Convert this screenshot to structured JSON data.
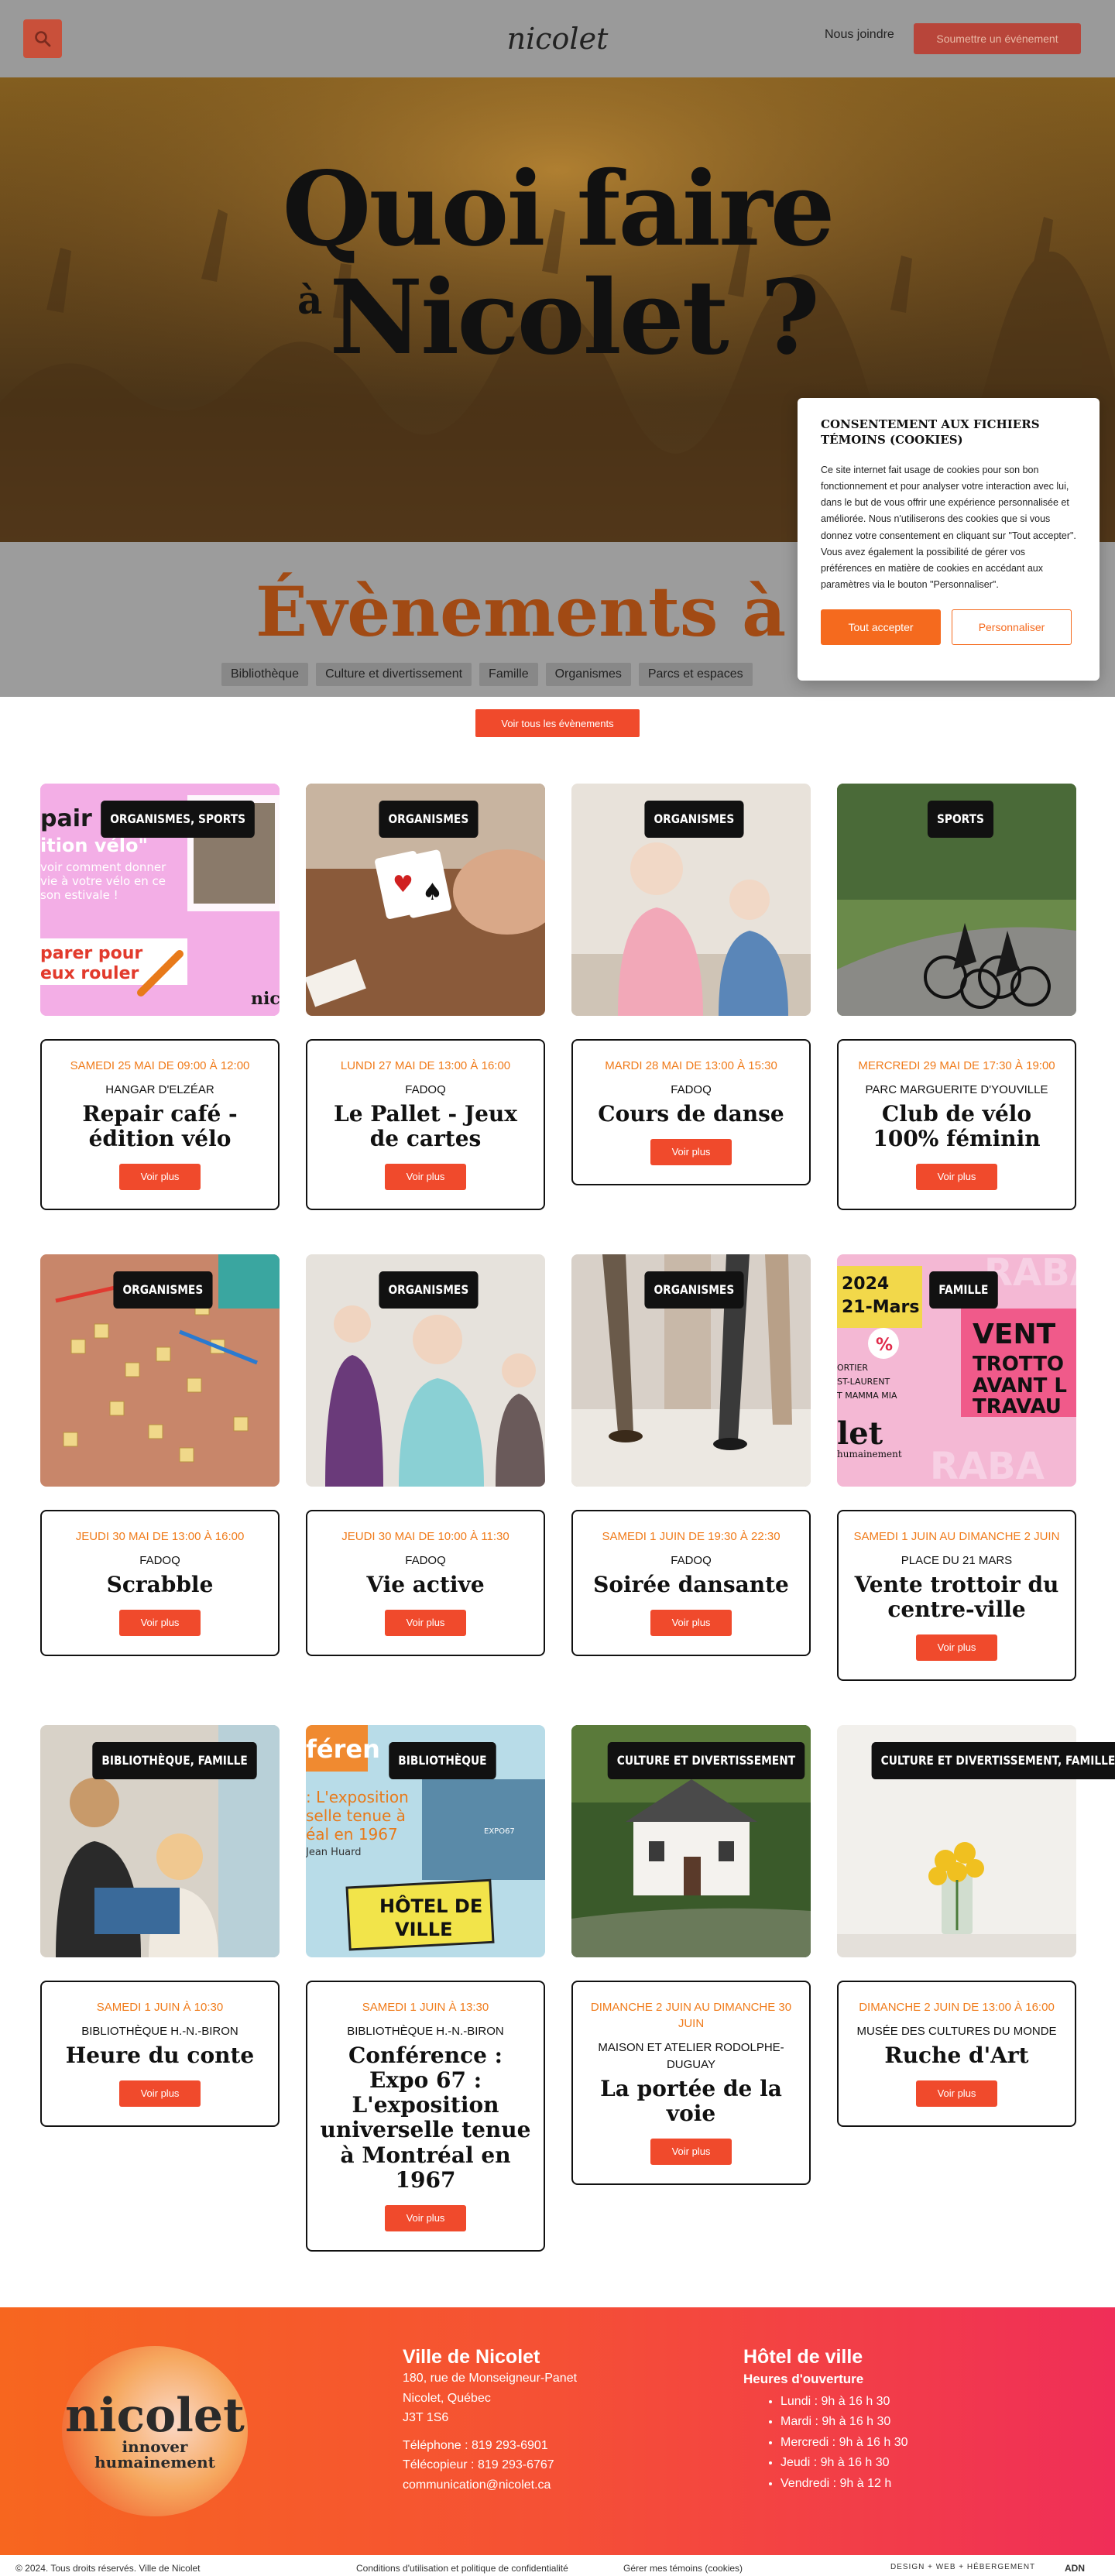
{
  "header": {
    "logo_text": "nicolet",
    "join_label": "Nous joindre",
    "submit_label": "Soumettre un événement"
  },
  "hero": {
    "line1": "Quoi faire",
    "small_a": "à",
    "line2": "Nicolet ?"
  },
  "events_section": {
    "title": "Évènements à venir",
    "filters": [
      "Bibliothèque",
      "Culture et divertissement",
      "Famille",
      "Organismes",
      "Parcs et espaces"
    ],
    "all_button": "Voir tous les évènements"
  },
  "cookie": {
    "title": "Consentement aux fichiers témoins (cookies)",
    "body": "Ce site internet fait usage de cookies pour son bon fonctionnement et pour analyser votre interaction avec lui, dans le but de vous offrir une expérience personnalisée et améliorée. Nous n'utiliserons des cookies que si vous donnez votre consentement en cliquant sur \"Tout accepter\". Vous avez également la possibilité de gérer vos préférences en matière de cookies en accédant aux paramètres via le bouton \"Personnaliser\".",
    "accept": "Tout accepter",
    "customize": "Personnaliser"
  },
  "more_label": "Voir plus",
  "events": [
    {
      "tag": "ORGANISMES, SPORTS",
      "date": "SAMEDI 25 MAI DE 09:00 À 12:00",
      "venue": "HANGAR D'ELZÉAR",
      "title": "Repair café - édition vélo",
      "theme": "pink"
    },
    {
      "tag": "ORGANISMES",
      "date": "LUNDI 27 MAI DE 13:00 À 16:00",
      "venue": "FADOQ",
      "title": "Le Pallet - Jeux de cartes",
      "theme": "cards"
    },
    {
      "tag": "ORGANISMES",
      "date": "MARDI 28 MAI DE 13:00 À 15:30",
      "venue": "FADOQ",
      "title": "Cours de danse",
      "theme": "dance"
    },
    {
      "tag": "SPORTS",
      "date": "MERCREDI 29 MAI DE 17:30 À 19:00",
      "venue": "PARC MARGUERITE D'YOUVILLE",
      "title": "Club de vélo 100% féminin",
      "theme": "bike"
    },
    {
      "tag": "ORGANISMES",
      "date": "JEUDI 30 MAI DE 13:00 À 16:00",
      "venue": "FADOQ",
      "title": "Scrabble",
      "theme": "scrabble"
    },
    {
      "tag": "ORGANISMES",
      "date": "JEUDI 30 MAI DE 10:00 À 11:30",
      "venue": "FADOQ",
      "title": "Vie active",
      "theme": "active"
    },
    {
      "tag": "ORGANISMES",
      "date": "SAMEDI 1 JUIN DE 19:30 À 22:30",
      "venue": "FADOQ",
      "title": "Soirée dansante",
      "theme": "ballroom"
    },
    {
      "tag": "FAMILLE",
      "date": "SAMEDI 1 JUIN AU DIMANCHE 2 JUIN",
      "venue": "PLACE DU 21 MARS",
      "title": "Vente trottoir du centre-ville",
      "theme": "sale"
    },
    {
      "tag": "BIBLIOTHÈQUE, FAMILLE",
      "date": "SAMEDI 1 JUIN À 10:30",
      "venue": "BIBLIOTHÈQUE H.-N.-BIRON",
      "title": "Heure du conte",
      "theme": "story"
    },
    {
      "tag": "BIBLIOTHÈQUE",
      "date": "SAMEDI 1 JUIN À 13:30",
      "venue": "BIBLIOTHÈQUE H.-N.-BIRON",
      "title": "Conférence : Expo 67 : L'exposition universelle tenue à Montréal en 1967",
      "theme": "expo"
    },
    {
      "tag": "CULTURE ET DIVERTISSEMENT",
      "date": "DIMANCHE 2 JUIN AU DIMANCHE 30 JUIN",
      "venue": "MAISON ET ATELIER RODOLPHE-DUGUAY",
      "title": "La portée de la voie",
      "theme": "house"
    },
    {
      "tag": "CULTURE ET DIVERTISSEMENT, FAMILLE",
      "date": "DIMANCHE 2 JUIN DE 13:00 À 16:00",
      "venue": "MUSÉE DES CULTURES DU MONDE",
      "title": "Ruche d'Art",
      "theme": "flowers"
    }
  ],
  "img_text": {
    "pink_1": "pair",
    "pink_2": "ition vélo\"",
    "pink_3": "voir comment donner",
    "pink_4": "vie à votre vélo en ce",
    "pink_5": "son estivale !",
    "pink_6": "parer pour",
    "pink_7": "eux rouler",
    "pink_logo": "nic",
    "sale_1": "2024",
    "sale_2": "21-Mars",
    "sale_3": "VENT",
    "sale_4": "TROTTO",
    "sale_5": "AVANT L",
    "sale_6": "TRAVAU",
    "sale_7": "RABA",
    "sale_8": "RABA",
    "sale_9": "ORTIER",
    "sale_10": "ST-LAURENT",
    "sale_11": "T MAMMA MIA",
    "sale_12": "let",
    "sale_13": "humainement",
    "sale_pct": "%",
    "expo_1": "féren",
    "expo_2": ": L'exposition",
    "expo_3": "selle tenue à",
    "expo_4": "éal en 1967",
    "expo_5": "Jean Huard",
    "expo_6": "HÔTEL DE",
    "expo_7": "VILLE",
    "expo_8": "EXPO67"
  },
  "footer": {
    "logo_name": "nicolet",
    "logo_tag1": "innover",
    "logo_tag2": "humainement",
    "city": {
      "title": "Ville de Nicolet",
      "address1": "180, rue de Monseigneur-Panet",
      "address2": "Nicolet, Québec",
      "postal": "J3T 1S6",
      "phone": "Téléphone : 819 293-6901",
      "fax": "Télécopieur : 819 293-6767",
      "email": "communication@nicolet.ca"
    },
    "hall": {
      "title": "Hôtel de ville",
      "subtitle": "Heures d'ouverture",
      "hours": [
        "Lundi : 9h à 16 h 30",
        "Mardi : 9h à 16 h 30",
        "Mercredi : 9h à 16 h 30",
        "Jeudi : 9h à 16 h 30",
        "Vendredi : 9h à 12 h"
      ]
    }
  },
  "bottom": {
    "copyright": "© 2024. Tous droits réservés. Ville de Nicolet",
    "terms": "Conditions d'utilisation et politique de confidentialité",
    "cookies": "Gérer mes témoins (cookies)",
    "credit": "DESIGN + WEB + HÉBERGEMENT",
    "credit_logo": "ADN"
  }
}
